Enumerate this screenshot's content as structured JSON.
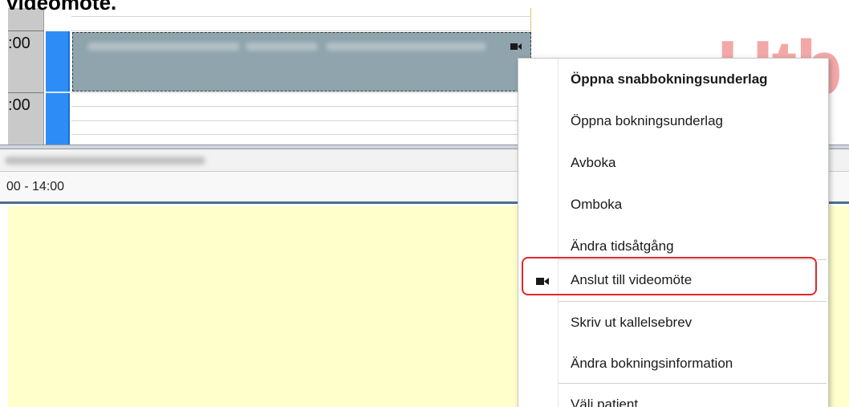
{
  "page": {
    "heading": "videomöte."
  },
  "calendar": {
    "time_labels": [
      ":00",
      ":00"
    ],
    "time_range": "00 - 14:00"
  },
  "context_menu": {
    "items": [
      {
        "label": "Öppna snabbokningsunderlag",
        "bold": true
      },
      {
        "label": "Öppna bokningsunderlag"
      },
      {
        "label": "Avboka"
      },
      {
        "label": "Omboka"
      },
      {
        "label": "Ändra tidsåtgång"
      },
      {
        "label": "Anslut till videomöte",
        "icon": "video-camera-icon",
        "highlighted": true
      },
      {
        "label": "Skriv ut kallelsebrev"
      },
      {
        "label": "Ändra bokningsinformation"
      },
      {
        "label": "Välj patient"
      }
    ]
  },
  "watermark": "Utb",
  "colors": {
    "appointment": "#8fa4ad",
    "resource_strip": "#2e8cf7",
    "notes_background": "#ffffcc",
    "highlight": "#e02828",
    "watermark": "#f29a9a"
  }
}
